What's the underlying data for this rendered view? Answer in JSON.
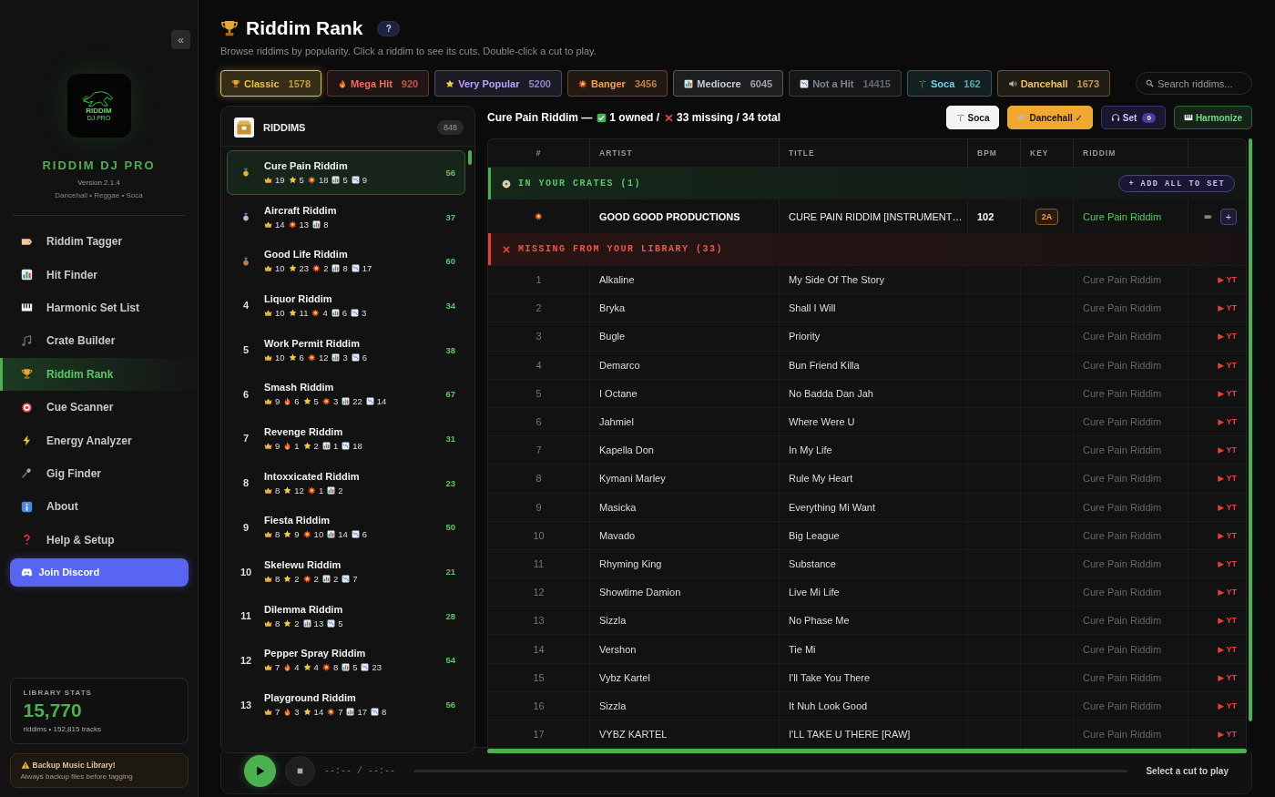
{
  "sidebar": {
    "collapse": "«",
    "logo": {
      "text": "RIDDIM",
      "subtext": "DJ PRO"
    },
    "app_name": "RIDDIM DJ PRO",
    "version": "Version 2.1.4",
    "genres": "Dancehall • Reggae • Soca",
    "nav": [
      {
        "kind": "tag",
        "label": "Riddim Tagger",
        "selected": false
      },
      {
        "kind": "bars",
        "label": "Hit Finder",
        "selected": false
      },
      {
        "kind": "piano",
        "label": "Harmonic Set List",
        "selected": false
      },
      {
        "kind": "notes",
        "label": "Crate Builder",
        "selected": false
      },
      {
        "kind": "trophy",
        "label": "Riddim Rank",
        "selected": true
      },
      {
        "kind": "target",
        "label": "Cue Scanner",
        "selected": false
      },
      {
        "kind": "bolt",
        "label": "Energy Analyzer",
        "selected": false
      },
      {
        "kind": "mic",
        "label": "Gig Finder",
        "selected": false
      },
      {
        "kind": "info",
        "label": "About",
        "selected": false
      },
      {
        "kind": "question",
        "label": "Help & Setup",
        "selected": false
      }
    ],
    "discord": "Join Discord",
    "stats": {
      "heading": "LIBRARY STATS",
      "value": "15,770",
      "caption": "riddims • 152,815 tracks"
    },
    "notice": {
      "title": "Backup Music Library!",
      "text": "Always backup files before tagging"
    }
  },
  "header": {
    "title": "Riddim Rank",
    "help": "?",
    "subtitle": "Browse riddims by popularity. Click a riddim to see its cuts. Double-click a cut to play."
  },
  "filters": [
    {
      "kind": "trophy",
      "label": "Classic",
      "count": "1578",
      "color": "#e8c34a",
      "selected": true
    },
    {
      "kind": "fire",
      "label": "Mega Hit",
      "count": "920",
      "color": "#ef6f5e",
      "selected": false
    },
    {
      "kind": "star",
      "label": "Very Popular",
      "count": "5200",
      "color": "#b9a4ff",
      "selected": false
    },
    {
      "kind": "boom",
      "label": "Banger",
      "count": "3456",
      "color": "#f0a050",
      "selected": false
    },
    {
      "kind": "bars",
      "label": "Mediocre",
      "count": "6045",
      "color": "#c8ccd4",
      "selected": false
    },
    {
      "kind": "down",
      "label": "Not a Hit",
      "count": "14415",
      "color": "#80858e",
      "selected": false
    },
    {
      "kind": "palm",
      "label": "Soca",
      "count": "162",
      "color": "#6fd3e0",
      "selected": false
    },
    {
      "kind": "speaker",
      "label": "Dancehall",
      "count": "1673",
      "color": "#f0c060",
      "selected": false
    }
  ],
  "search": {
    "placeholder": "Search riddims..."
  },
  "riddims": {
    "heading": "RIDDIMS",
    "count": "848",
    "items": [
      {
        "kind": "medal",
        "color": "#e8b030",
        "name": "Cure Pain Riddim",
        "total": "56",
        "selected": true,
        "stats": [
          {
            "kind": "crown",
            "count": "19"
          },
          {
            "kind": "star",
            "count": "5"
          },
          {
            "kind": "boom",
            "count": "18"
          },
          {
            "kind": "bars",
            "count": "5"
          },
          {
            "kind": "down",
            "count": "9"
          }
        ]
      },
      {
        "kind": "medal",
        "color": "#b8bcc4",
        "name": "Aircraft Riddim",
        "total": "37",
        "selected": false,
        "stats": [
          {
            "kind": "crown",
            "count": "14"
          },
          {
            "kind": "boom",
            "count": "13"
          },
          {
            "kind": "bars",
            "count": "8"
          }
        ]
      },
      {
        "kind": "medal",
        "color": "#c87838",
        "name": "Good Life Riddim",
        "total": "60",
        "selected": false,
        "stats": [
          {
            "kind": "crown",
            "count": "10"
          },
          {
            "kind": "star",
            "count": "23"
          },
          {
            "kind": "boom",
            "count": "2"
          },
          {
            "kind": "bars",
            "count": "8"
          },
          {
            "kind": "down",
            "count": "17"
          }
        ]
      },
      {
        "kind": "number",
        "rank": "4",
        "name": "Liquor Riddim",
        "total": "34",
        "selected": false,
        "stats": [
          {
            "kind": "crown",
            "count": "10"
          },
          {
            "kind": "star",
            "count": "11"
          },
          {
            "kind": "boom",
            "count": "4"
          },
          {
            "kind": "bars",
            "count": "6"
          },
          {
            "kind": "down",
            "count": "3"
          }
        ]
      },
      {
        "kind": "number",
        "rank": "5",
        "name": "Work Permit Riddim",
        "total": "38",
        "selected": false,
        "stats": [
          {
            "kind": "crown",
            "count": "10"
          },
          {
            "kind": "star",
            "count": "6"
          },
          {
            "kind": "boom",
            "count": "12"
          },
          {
            "kind": "bars",
            "count": "3"
          },
          {
            "kind": "down",
            "count": "6"
          }
        ]
      },
      {
        "kind": "number",
        "rank": "6",
        "name": "Smash Riddim",
        "total": "67",
        "selected": false,
        "stats": [
          {
            "kind": "crown",
            "count": "9"
          },
          {
            "kind": "fire",
            "count": "6"
          },
          {
            "kind": "star",
            "count": "5"
          },
          {
            "kind": "boom",
            "count": "3"
          },
          {
            "kind": "bars",
            "count": "22"
          },
          {
            "kind": "down",
            "count": "14"
          }
        ]
      },
      {
        "kind": "number",
        "rank": "7",
        "name": "Revenge Riddim",
        "total": "31",
        "selected": false,
        "stats": [
          {
            "kind": "crown",
            "count": "9"
          },
          {
            "kind": "fire",
            "count": "1"
          },
          {
            "kind": "star",
            "count": "2"
          },
          {
            "kind": "bars",
            "count": "1"
          },
          {
            "kind": "down",
            "count": "18"
          }
        ]
      },
      {
        "kind": "number",
        "rank": "8",
        "name": "Intoxxicated Riddim",
        "total": "23",
        "selected": false,
        "stats": [
          {
            "kind": "crown",
            "count": "8"
          },
          {
            "kind": "star",
            "count": "12"
          },
          {
            "kind": "boom",
            "count": "1"
          },
          {
            "kind": "bars",
            "count": "2"
          }
        ]
      },
      {
        "kind": "number",
        "rank": "9",
        "name": "Fiesta Riddim",
        "total": "50",
        "selected": false,
        "stats": [
          {
            "kind": "crown",
            "count": "8"
          },
          {
            "kind": "star",
            "count": "9"
          },
          {
            "kind": "boom",
            "count": "10"
          },
          {
            "kind": "bars",
            "count": "14"
          },
          {
            "kind": "down",
            "count": "6"
          }
        ]
      },
      {
        "kind": "number",
        "rank": "10",
        "name": "Skelewu Riddim",
        "total": "21",
        "selected": false,
        "stats": [
          {
            "kind": "crown",
            "count": "8"
          },
          {
            "kind": "star",
            "count": "2"
          },
          {
            "kind": "boom",
            "count": "2"
          },
          {
            "kind": "bars",
            "count": "2"
          },
          {
            "kind": "down",
            "count": "7"
          }
        ]
      },
      {
        "kind": "number",
        "rank": "11",
        "name": "Dilemma Riddim",
        "total": "28",
        "selected": false,
        "stats": [
          {
            "kind": "crown",
            "count": "8"
          },
          {
            "kind": "star",
            "count": "2"
          },
          {
            "kind": "bars",
            "count": "13"
          },
          {
            "kind": "down",
            "count": "5"
          }
        ]
      },
      {
        "kind": "number",
        "rank": "12",
        "name": "Pepper Spray Riddim",
        "total": "54",
        "selected": false,
        "stats": [
          {
            "kind": "crown",
            "count": "7"
          },
          {
            "kind": "fire",
            "count": "4"
          },
          {
            "kind": "star",
            "count": "4"
          },
          {
            "kind": "boom",
            "count": "8"
          },
          {
            "kind": "bars",
            "count": "5"
          },
          {
            "kind": "down",
            "count": "23"
          }
        ]
      },
      {
        "kind": "number",
        "rank": "13",
        "name": "Playground Riddim",
        "total": "56",
        "selected": false,
        "stats": [
          {
            "kind": "crown",
            "count": "7"
          },
          {
            "kind": "fire",
            "count": "3"
          },
          {
            "kind": "star",
            "count": "14"
          },
          {
            "kind": "boom",
            "count": "7"
          },
          {
            "kind": "bars",
            "count": "17"
          },
          {
            "kind": "down",
            "count": "8"
          }
        ]
      }
    ]
  },
  "detail": {
    "riddim": "Cure Pain Riddim —",
    "owned": "1 owned /",
    "missing": "33 missing / 34 total",
    "buttons": [
      {
        "kind": "genre",
        "label": "Soca",
        "selected": true
      },
      {
        "kind": "genre",
        "label": "Dancehall ✓",
        "selected": true
      },
      {
        "kind": "set",
        "label": "Set",
        "count": "0"
      },
      {
        "kind": "action",
        "label": "Harmonize"
      }
    ]
  },
  "table": {
    "columns": [
      "#",
      "ARTIST",
      "TITLE",
      "BPM",
      "KEY",
      "RIDDIM"
    ],
    "owned_section": {
      "label": "IN YOUR CRATES (1)",
      "action": "+ ADD ALL TO SET"
    },
    "owned": [
      {
        "artist": "GOOD GOOD PRODUCTIONS",
        "title": "CURE PAIN RIDDIM [INSTRUMENT…",
        "bpm": "102",
        "key": "2A",
        "riddim": "Cure Pain Riddim",
        "add": "+"
      }
    ],
    "missing_section": {
      "label": "MISSING FROM YOUR LIBRARY (33)"
    },
    "missing": [
      {
        "num": "1",
        "artist": "Alkaline",
        "title": "My Side Of The Story",
        "riddim": "Cure Pain Riddim",
        "link": "▶ YT"
      },
      {
        "num": "2",
        "artist": "Bryka",
        "title": "Shall I Will",
        "riddim": "Cure Pain Riddim",
        "link": "▶ YT"
      },
      {
        "num": "3",
        "artist": "Bugle",
        "title": "Priority",
        "riddim": "Cure Pain Riddim",
        "link": "▶ YT"
      },
      {
        "num": "4",
        "artist": "Demarco",
        "title": "Bun Friend Killa",
        "riddim": "Cure Pain Riddim",
        "link": "▶ YT"
      },
      {
        "num": "5",
        "artist": "I Octane",
        "title": "No Badda Dan Jah",
        "riddim": "Cure Pain Riddim",
        "link": "▶ YT"
      },
      {
        "num": "6",
        "artist": "Jahmiel",
        "title": "Where Were U",
        "riddim": "Cure Pain Riddim",
        "link": "▶ YT"
      },
      {
        "num": "7",
        "artist": "Kapella Don",
        "title": "In My Life",
        "riddim": "Cure Pain Riddim",
        "link": "▶ YT"
      },
      {
        "num": "8",
        "artist": "Kymani Marley",
        "title": "Rule My Heart",
        "riddim": "Cure Pain Riddim",
        "link": "▶ YT"
      },
      {
        "num": "9",
        "artist": "Masicka",
        "title": "Everything Mi Want",
        "riddim": "Cure Pain Riddim",
        "link": "▶ YT"
      },
      {
        "num": "10",
        "artist": "Mavado",
        "title": "Big League",
        "riddim": "Cure Pain Riddim",
        "link": "▶ YT"
      },
      {
        "num": "11",
        "artist": "Rhyming King",
        "title": "Substance",
        "riddim": "Cure Pain Riddim",
        "link": "▶ YT"
      },
      {
        "num": "12",
        "artist": "Showtime Damion",
        "title": "Live Mi Life",
        "riddim": "Cure Pain Riddim",
        "link": "▶ YT"
      },
      {
        "num": "13",
        "artist": "Sizzla",
        "title": "No Phase Me",
        "riddim": "Cure Pain Riddim",
        "link": "▶ YT"
      },
      {
        "num": "14",
        "artist": "Vershon",
        "title": "Tie Mi",
        "riddim": "Cure Pain Riddim",
        "link": "▶ YT"
      },
      {
        "num": "15",
        "artist": "Vybz Kartel",
        "title": "I'll Take You There",
        "riddim": "Cure Pain Riddim",
        "link": "▶ YT"
      },
      {
        "num": "16",
        "artist": "Sizzla",
        "title": "It Nuh Look Good",
        "riddim": "Cure Pain Riddim",
        "link": "▶ YT"
      },
      {
        "num": "17",
        "artist": "VYBZ KARTEL",
        "title": "I'LL TAKE U THERE [RAW]",
        "riddim": "Cure Pain Riddim",
        "link": "▶ YT"
      }
    ]
  },
  "player": {
    "time": "--:-- / --:--",
    "status": "Select a cut to play"
  }
}
